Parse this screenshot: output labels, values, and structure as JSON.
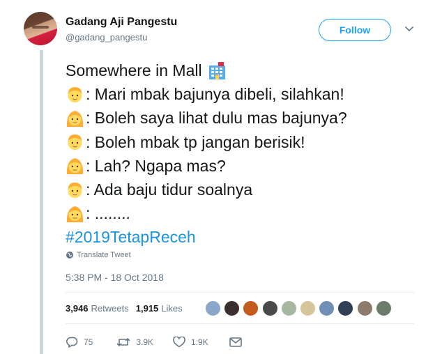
{
  "user": {
    "display_name": "Gadang Aji Pangestu",
    "handle": "@gadang_pangestu"
  },
  "follow_label": "Follow",
  "tweet": {
    "lines": [
      {
        "speaker": "",
        "text": "Somewhere in Mall",
        "trailing_icon": "office-building-emoji"
      },
      {
        "speaker": "man-emoji",
        "text": ": Mari mbak bajunya dibeli, silahkan!"
      },
      {
        "speaker": "woman-emoji",
        "text": ": Boleh saya lihat dulu mas bajunya?"
      },
      {
        "speaker": "man-emoji",
        "text": ": Boleh mbak tp jangan berisik!"
      },
      {
        "speaker": "woman-emoji",
        "text": ": Lah? Ngapa mas?"
      },
      {
        "speaker": "man-emoji",
        "text": ": Ada baju tidur soalnya"
      },
      {
        "speaker": "woman-emoji",
        "text": ": ........"
      }
    ],
    "hashtag": "#2019TetapReceh"
  },
  "translate_label": "Translate Tweet",
  "timestamp": "5:38 PM - 18 Oct 2018",
  "stats": {
    "retweets_count": "3,946",
    "retweets_label": "Retweets",
    "likes_count": "1,915",
    "likes_label": "Likes"
  },
  "liker_avatar_count": 10,
  "actions": {
    "replies": "75",
    "retweets": "3.9K",
    "likes": "1.9K"
  },
  "colors": {
    "accent": "#1da1f2",
    "hashtag": "#1b95e0",
    "muted": "#657786",
    "thread_line": "#ccd6dd"
  }
}
